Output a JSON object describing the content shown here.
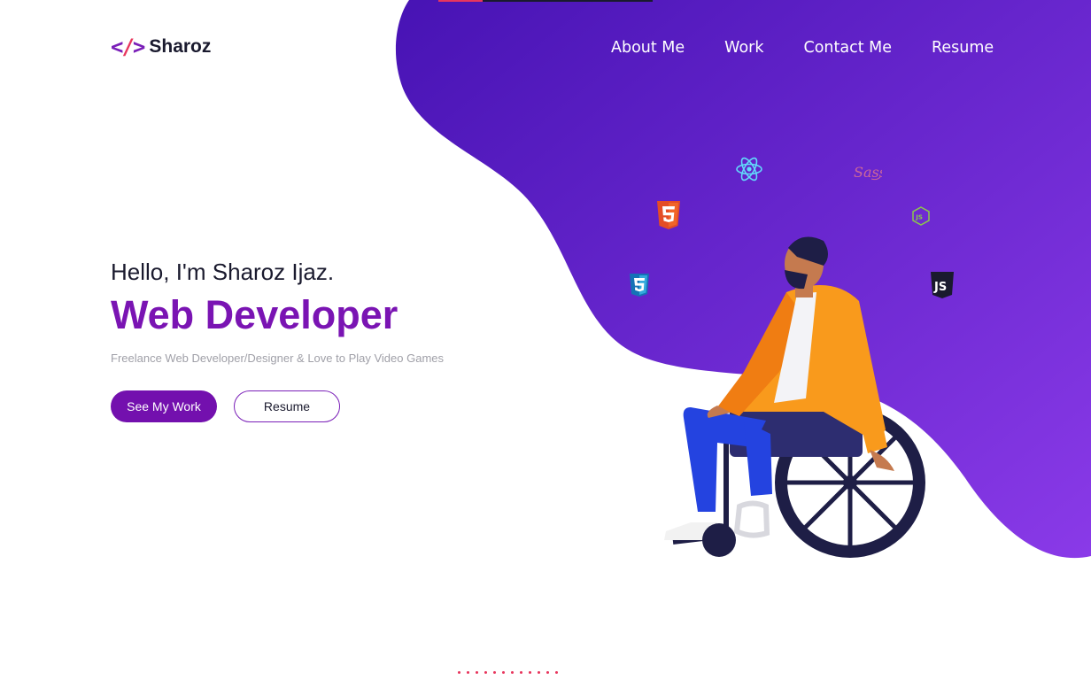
{
  "brand": {
    "name": "Sharoz",
    "icon": "code-brackets-icon"
  },
  "nav": {
    "items": [
      {
        "label": "About Me"
      },
      {
        "label": "Work"
      },
      {
        "label": "Contact Me"
      },
      {
        "label": "Resume"
      }
    ]
  },
  "hero": {
    "greeting": "Hello, I'm Sharoz Ijaz.",
    "role": "Web Developer",
    "tagline": "Freelance Web Developer/Designer & Love to Play Video Games",
    "primary_button": "See My Work",
    "secondary_button": "Resume"
  },
  "tech_icons": [
    "react-icon",
    "sass-icon",
    "html5-icon",
    "nodejs-icon",
    "css3-icon",
    "javascript-icon"
  ],
  "illustration": "person-in-wheelchair-illustration",
  "colors": {
    "accent": "#7a14b3",
    "blob_start": "#4a16b8",
    "blob_end": "#8a3ae8",
    "pink": "#e8365d"
  },
  "dots_count": 12
}
